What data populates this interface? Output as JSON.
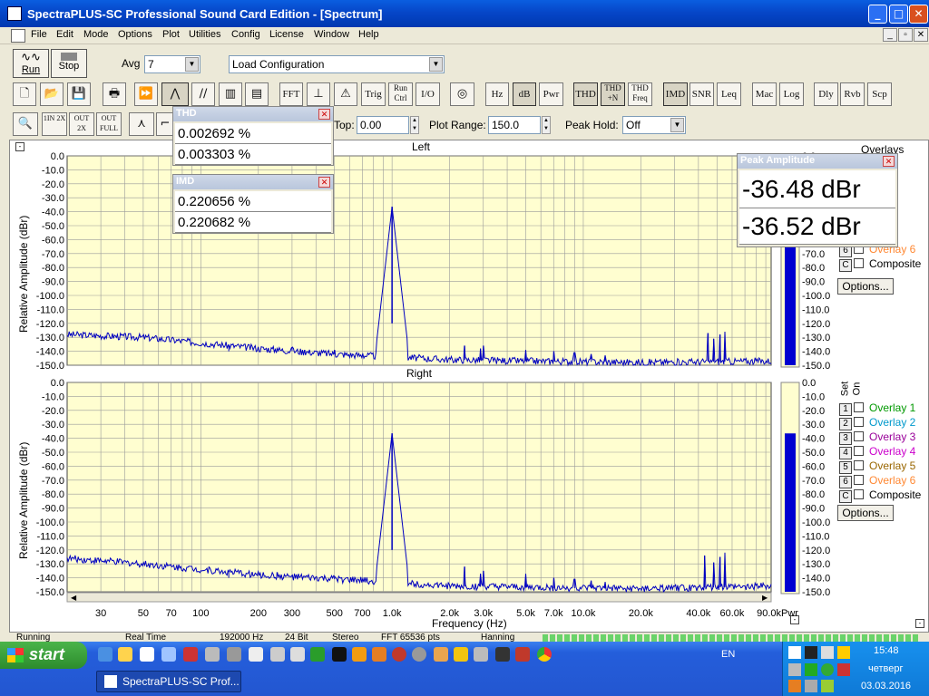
{
  "window": {
    "title": "SpectraPLUS-SC Professional Sound Card Edition - [Spectrum]",
    "minimize": "_",
    "maximize": "□",
    "close": "✕"
  },
  "menu": [
    "File",
    "Edit",
    "Mode",
    "Options",
    "Plot",
    "Utilities",
    "Config",
    "License",
    "Window",
    "Help"
  ],
  "controls": {
    "run_label": "Run",
    "stop_label": "Stop",
    "avg_label": "Avg",
    "avg_value": "7",
    "config_value": "Load Configuration",
    "top_label": "Top:",
    "top_value": "0.00",
    "plot_range_label": "Plot Range:",
    "plot_range_value": "150.0",
    "peak_hold_label": "Peak Hold:",
    "peak_hold_value": "Off"
  },
  "toolbar_text": [
    "FFT",
    "Trig",
    "Run Ctrl",
    "I/O",
    "Hz",
    "dB",
    "Pwr",
    "THD",
    "THD +N",
    "THD Freq",
    "IMD",
    "SNR",
    "Leq",
    "Mac",
    "Log",
    "Dly",
    "Rvb",
    "Scp"
  ],
  "toolbar2_text": [
    "1IN 2X",
    "OUT 2X",
    "OUT FULL"
  ],
  "thd_popup": {
    "title": "THD",
    "v1": "0.002692 %",
    "v2": "0.003303 %"
  },
  "imd_popup": {
    "title": "IMD",
    "v1": "0.220656 %",
    "v2": "0.220682 %"
  },
  "peak_popup": {
    "title": "Peak Amplitude",
    "v1": "-36.48 dBr",
    "v2": "-36.52 dBr"
  },
  "overlays_header": "Overlays",
  "set_on_labels": {
    "set": "Set",
    "on": "On"
  },
  "overlay_rows": [
    {
      "num": "1",
      "label": "Overlay 1",
      "color": "#009900"
    },
    {
      "num": "2",
      "label": "Overlay 2",
      "color": "#0099cc"
    },
    {
      "num": "3",
      "label": "Overlay 3",
      "color": "#990099"
    },
    {
      "num": "4",
      "label": "Overlay 4",
      "color": "#cc00cc"
    },
    {
      "num": "5",
      "label": "Overlay 5",
      "color": "#996600"
    },
    {
      "num": "6",
      "label": "Overlay 6",
      "color": "#ff8833"
    },
    {
      "num": "C",
      "label": "Composite",
      "color": "#000000"
    }
  ],
  "options_label": "Options...",
  "pwr_label": "Pwr",
  "chart_data": [
    {
      "type": "line",
      "title": "Left",
      "xlabel": "Frequency (Hz)",
      "ylabel": "Relative Amplitude (dBr)",
      "xscale": "log",
      "xlim": [
        20,
        96000
      ],
      "ylim": [
        -150,
        0
      ],
      "grid": true,
      "x_ticks": [
        "30",
        "50",
        "70",
        "100",
        "200",
        "300",
        "500",
        "700",
        "1.0k",
        "2.0k",
        "3.0k",
        "5.0k",
        "7.0k",
        "10.0k",
        "20.0k",
        "40.0k",
        "60.0k",
        "90.0kPwr"
      ],
      "y_ticks": [
        "0.0",
        "-10.0",
        "-20.0",
        "-30.0",
        "-40.0",
        "-50.0",
        "-60.0",
        "-70.0",
        "-80.0",
        "-90.0",
        "-100.0",
        "-110.0",
        "-120.0",
        "-130.0",
        "-140.0",
        "-150.0"
      ],
      "peak": {
        "x": 1000,
        "y": -36.48
      },
      "noise_floor": [
        [
          20,
          -128
        ],
        [
          50,
          -130
        ],
        [
          100,
          -134
        ],
        [
          200,
          -138
        ],
        [
          500,
          -142
        ],
        [
          1000,
          -144
        ],
        [
          2000,
          -146
        ],
        [
          5000,
          -147
        ],
        [
          20000,
          -148
        ],
        [
          96000,
          -147
        ]
      ],
      "spurs": [
        [
          140,
          -140
        ],
        [
          250,
          -138
        ],
        [
          300,
          -137
        ],
        [
          350,
          -139
        ],
        [
          500,
          -139
        ],
        [
          700,
          -142
        ],
        [
          2400,
          -136
        ],
        [
          2900,
          -138
        ],
        [
          3000,
          -136
        ],
        [
          5000,
          -139
        ],
        [
          7000,
          -140
        ],
        [
          9000,
          -141
        ],
        [
          11000,
          -142
        ],
        [
          13000,
          -143
        ],
        [
          45000,
          -127
        ],
        [
          48000,
          -131
        ],
        [
          52000,
          -128
        ],
        [
          55000,
          -126
        ]
      ],
      "meter_level_dBr": -36.48
    },
    {
      "type": "line",
      "title": "Right",
      "xlabel": "Frequency (Hz)",
      "ylabel": "Relative Amplitude (dBr)",
      "xscale": "log",
      "xlim": [
        20,
        96000
      ],
      "ylim": [
        -150,
        0
      ],
      "grid": true,
      "x_ticks": [
        "30",
        "50",
        "70",
        "100",
        "200",
        "300",
        "500",
        "700",
        "1.0k",
        "2.0k",
        "3.0k",
        "5.0k",
        "7.0k",
        "10.0k",
        "20.0k",
        "40.0k",
        "60.0k",
        "90.0kPwr"
      ],
      "y_ticks": [
        "0.0",
        "-10.0",
        "-20.0",
        "-30.0",
        "-40.0",
        "-50.0",
        "-60.0",
        "-70.0",
        "-80.0",
        "-90.0",
        "-100.0",
        "-110.0",
        "-120.0",
        "-130.0",
        "-140.0",
        "-150.0"
      ],
      "peak": {
        "x": 1000,
        "y": -36.52
      },
      "noise_floor": [
        [
          20,
          -126
        ],
        [
          50,
          -130
        ],
        [
          100,
          -134
        ],
        [
          200,
          -138
        ],
        [
          500,
          -141
        ],
        [
          1000,
          -143
        ],
        [
          2000,
          -146
        ],
        [
          5000,
          -147
        ],
        [
          20000,
          -148
        ],
        [
          96000,
          -146
        ]
      ],
      "spurs": [
        [
          140,
          -140
        ],
        [
          250,
          -136
        ],
        [
          300,
          -138
        ],
        [
          350,
          -139
        ],
        [
          500,
          -139
        ],
        [
          700,
          -141
        ],
        [
          2400,
          -132
        ],
        [
          2900,
          -137
        ],
        [
          3000,
          -135
        ],
        [
          5000,
          -137
        ],
        [
          7000,
          -140
        ],
        [
          9000,
          -141
        ],
        [
          11000,
          -142
        ],
        [
          13000,
          -143
        ],
        [
          43000,
          -124
        ],
        [
          48000,
          -129
        ],
        [
          52000,
          -125
        ],
        [
          55000,
          -122
        ]
      ],
      "meter_level_dBr": -36.52
    }
  ],
  "statusbar": [
    "Running",
    "Real Time",
    "192000 Hz",
    "24 Bit",
    "Stereo",
    "FFT 65536 pts",
    "Hanning"
  ],
  "taskbar": {
    "start_label": "start",
    "task_label": "SpectraPLUS-SC Prof...",
    "lang": "EN",
    "time": "15:48",
    "day": "четверг",
    "date": "03.03.2016"
  }
}
